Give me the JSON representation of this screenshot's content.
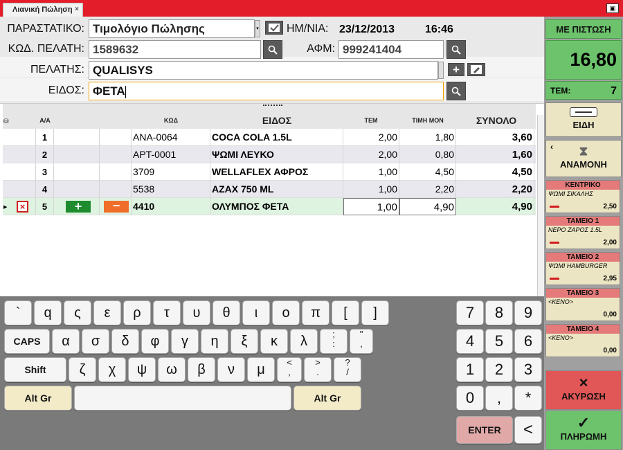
{
  "window": {
    "tab_title": "Λιανική Πώληση",
    "tab_close": "×",
    "window_button": "▣"
  },
  "form": {
    "doc_label": "ΠΑΡΑΣΤΑΤΙΚΟ:",
    "doc_value": "Τιμολόγιο Πώλησης",
    "date_label": "ΗΜ/ΝΙΑ:",
    "date_value": "23/12/2013",
    "time_value": "16:46",
    "code_label": "ΚΩΔ. ΠΕΛΑΤΗ:",
    "code_value": "1589632",
    "vat_label": "ΑΦΜ:",
    "vat_value": "999241404",
    "customer_label": "ΠΕΛΑΤΗΣ:",
    "customer_value": "QUALISYS",
    "item_label": "ΕΙΔΟΣ:",
    "item_value": "ΦΕΤΑ"
  },
  "grid": {
    "headers": {
      "aa": "Α/Α",
      "code": "ΚΩΔ",
      "item": "ΕΙΔΟΣ",
      "qty": "ΤΕΜ",
      "price": "ΤΙΜΗ ΜΟΝ",
      "total": "ΣΥΝΟΛΟ"
    },
    "rows": [
      {
        "aa": "1",
        "code": "ANA-0064",
        "item": "COCA COLA 1.5L",
        "qty": "2,00",
        "price": "1,80",
        "total": "3,60"
      },
      {
        "aa": "2",
        "code": "APT-0001",
        "item": "ΨΩΜΙ ΛΕΥΚΟ",
        "qty": "2,00",
        "price": "0,80",
        "total": "1,60"
      },
      {
        "aa": "3",
        "code": "3709",
        "item": "WELLAFLEX ΑΦΡΟΣ",
        "qty": "1,00",
        "price": "4,50",
        "total": "4,50"
      },
      {
        "aa": "4",
        "code": "5538",
        "item": "AZAX 750 ML",
        "qty": "1,00",
        "price": "2,20",
        "total": "2,20"
      },
      {
        "aa": "5",
        "code": "4410",
        "item": "ΟΛΥΜΠΟΣ ΦΕΤΑ",
        "qty": "1,00",
        "price": "4,90",
        "total": "4,90"
      }
    ]
  },
  "keyboard": {
    "row1": [
      "`",
      "q",
      "ς",
      "ε",
      "ρ",
      "τ",
      "υ",
      "θ",
      "ι",
      "ο",
      "π",
      "[",
      "]"
    ],
    "row2": [
      "CAPS",
      "α",
      "σ",
      "δ",
      "φ",
      "γ",
      "η",
      "ξ",
      "κ",
      "λ"
    ],
    "row2_extra": [
      ";",
      ":",
      "\"",
      ","
    ],
    "row3": [
      "Shift",
      "ζ",
      "χ",
      "ψ",
      "ω",
      "β",
      "ν",
      "μ"
    ],
    "row3_extra": [
      [
        "<",
        ","
      ],
      [
        ">",
        "."
      ],
      [
        "?",
        "/"
      ]
    ],
    "altgr": "Alt Gr",
    "numpad": [
      "7",
      "8",
      "9",
      "4",
      "5",
      "6",
      "1",
      "2",
      "3",
      "0",
      ",",
      "*"
    ],
    "enter": "ENTER",
    "back": "<"
  },
  "panel": {
    "credit_label": "ΜΕ ΠΙΣΤΩΣΗ",
    "total": "16,80",
    "items_label": "ΤΕΜ:",
    "items_count": "7",
    "items_btn": "ΕΙΔΗ",
    "wait_btn": "ΑΝΑΜΟΝΗ",
    "waits": [
      {
        "name": "ΚΕΝΤΡΙΚΟ",
        "item": "ΨΩΜΙ ΣΙΚΑΛΗΣ",
        "amount": "2,50"
      },
      {
        "name": "ΤΑΜΕΙΟ 1",
        "item": "ΝΕΡΟ ΖΑΡΟΣ 1.5L",
        "amount": "2,00"
      },
      {
        "name": "ΤΑΜΕΙΟ 2",
        "item": "ΨΩΜΙ HAMBURGER",
        "amount": "2,95"
      },
      {
        "name": "ΤΑΜΕΙΟ 3",
        "item": "<ΚΕΝΟ>",
        "amount": "0,00"
      },
      {
        "name": "ΤΑΜΕΙΟ 4",
        "item": "<ΚΕΝΟ>",
        "amount": "0,00"
      }
    ],
    "cancel": "ΑΚΥΡΩΣΗ",
    "pay": "ΠΛΗΡΩΜΗ"
  }
}
